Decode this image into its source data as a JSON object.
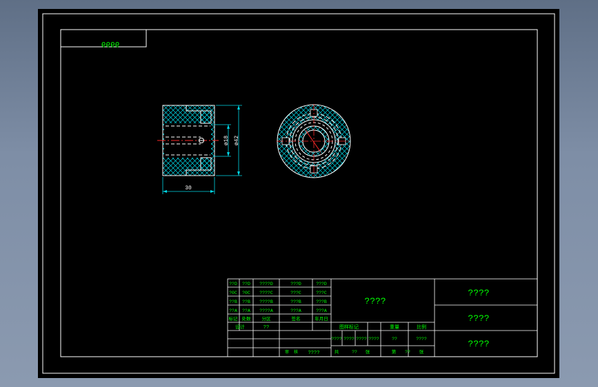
{
  "drawing": {
    "stamp_label": "6666",
    "dims": {
      "length": "30",
      "inner_dia": "ø18",
      "outer_dia": "ø42"
    }
  },
  "title_block": {
    "rev_table": [
      [
        "??D",
        "??D",
        "????D",
        "???D",
        "???D"
      ],
      [
        "?0C",
        "?0C",
        "????C",
        "???C",
        "???C"
      ],
      [
        "??B",
        "??B",
        "????B",
        "???B",
        "???B"
      ],
      [
        "??A",
        "??A",
        "????A",
        "???A",
        "???A"
      ],
      [
        "标记",
        "处数",
        "分区",
        "签名",
        "年月日"
      ]
    ],
    "design_row": [
      "设计",
      "??"
    ],
    "center_title": "????",
    "stage_header": [
      "图样标记",
      "重量",
      "比例"
    ],
    "stage_row": [
      "????",
      "????",
      "????",
      "????",
      "??",
      "????"
    ],
    "sheet_row": [
      "共",
      "??",
      "张",
      "第",
      "??",
      "张"
    ],
    "approval_row": [
      "审",
      "核",
      "????"
    ],
    "right_cells": [
      "????",
      "????",
      "????"
    ]
  },
  "colors": {
    "frame": "#ffffff",
    "text": "#00ff00",
    "cyan": "#00d8e8",
    "center": "#ff2a2a"
  }
}
